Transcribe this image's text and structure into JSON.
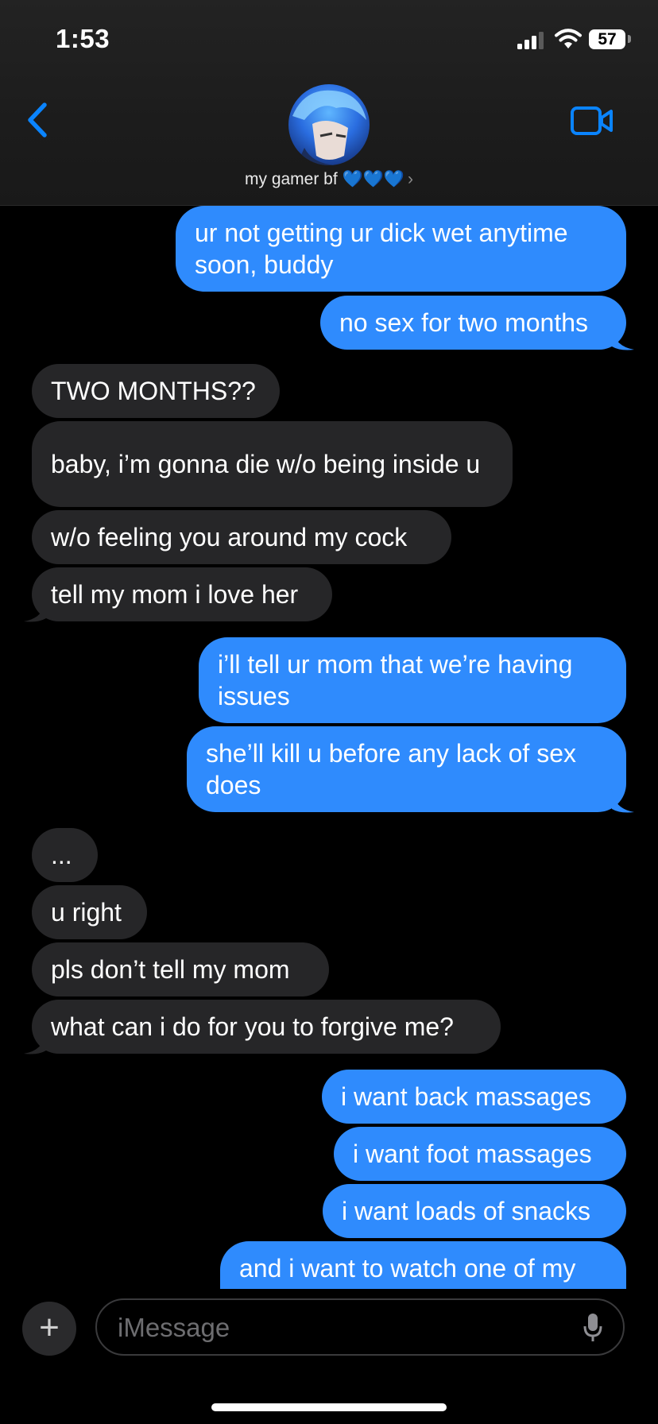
{
  "status_bar": {
    "time": "1:53",
    "battery": "57"
  },
  "header": {
    "contact_name": "my gamer bf 💙💙💙",
    "chevron": "›",
    "back_icon": "chevron-left-icon",
    "video_icon": "video-camera-icon"
  },
  "messages": [
    {
      "from": "me",
      "text": "ur not getting ur dick wet anytime soon, buddy"
    },
    {
      "from": "me",
      "text": "no sex for two months"
    },
    {
      "from": "them",
      "text": "TWO MONTHS??"
    },
    {
      "from": "them",
      "text": "baby, i’m gonna die w/o being inside u"
    },
    {
      "from": "them",
      "text": "w/o feeling you around my cock"
    },
    {
      "from": "them",
      "text": "tell my mom i love her"
    },
    {
      "from": "me",
      "text": "i’ll tell ur mom that we’re having issues"
    },
    {
      "from": "me",
      "text": "she’ll kill u before any lack of sex does"
    },
    {
      "from": "them",
      "text": "..."
    },
    {
      "from": "them",
      "text": "u right"
    },
    {
      "from": "them",
      "text": "pls don’t tell my mom"
    },
    {
      "from": "them",
      "text": "what can i do for you to forgive me?"
    },
    {
      "from": "me",
      "text": "i want back massages"
    },
    {
      "from": "me",
      "text": "i want foot massages"
    },
    {
      "from": "me",
      "text": "i want loads of snacks"
    },
    {
      "from": "me",
      "text": "and i want to watch one of my"
    }
  ],
  "composer": {
    "plus": "+",
    "placeholder": "iMessage"
  },
  "colors": {
    "sent": "#2f8bfd",
    "received": "#262628",
    "accent": "#0a84ff"
  }
}
